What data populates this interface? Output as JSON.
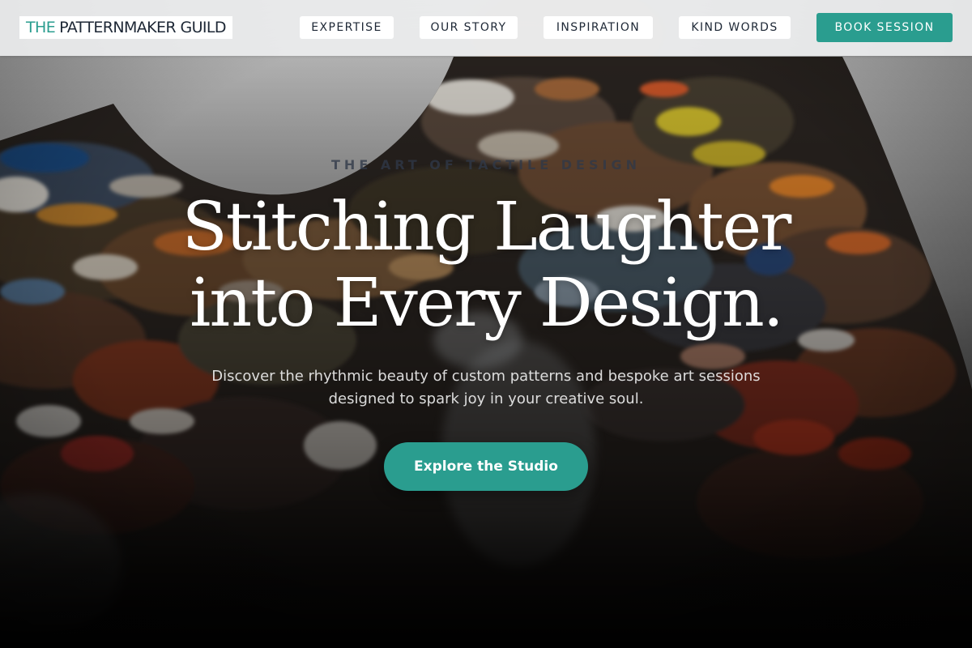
{
  "header": {
    "logo_accent": "THE",
    "logo_main": "PATTERNMAKER GUILD",
    "nav": [
      {
        "label": "EXPERTISE"
      },
      {
        "label": "OUR STORY"
      },
      {
        "label": "INSPIRATION"
      },
      {
        "label": "KIND WORDS"
      }
    ],
    "cta_label": "BOOK SESSION"
  },
  "hero": {
    "eyebrow": "THE ART OF TACTILE DESIGN",
    "title_line1": "Stitching Laughter",
    "title_line2": "into Every Design.",
    "subtitle": "Discover the rhythmic beauty of custom patterns and bespoke art sessions designed to spark joy in your creative soul.",
    "cta_label": "Explore the Studio"
  },
  "colors": {
    "accent": "#2a9d8f",
    "nav_text": "#1d2735",
    "header_bg": "#ecedee"
  }
}
